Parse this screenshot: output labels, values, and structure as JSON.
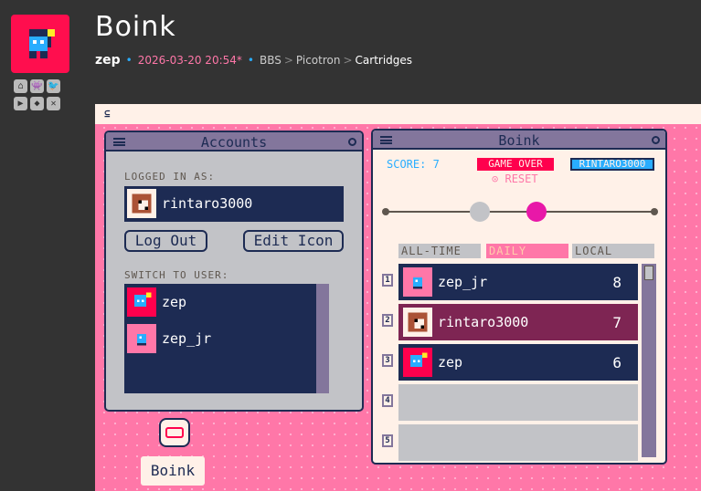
{
  "post": {
    "title": "Boink",
    "author": "zep",
    "date": "2026-03-20 20:54*",
    "breadcrumb": [
      "BBS",
      "Picotron",
      "Cartridges"
    ]
  },
  "colors": {
    "accent_pink": "#ff77a8",
    "navy": "#1d2b53",
    "red": "#ff004d",
    "blue": "#29adff",
    "magenta": "#e818a8",
    "wine": "#7e2553"
  },
  "accounts": {
    "title": "Accounts",
    "logged_in_label": "LOGGED IN AS:",
    "current_user": "rintaro3000",
    "logout_label": "Log Out",
    "edit_icon_label": "Edit Icon",
    "switch_label": "SWITCH TO USER:",
    "users": [
      "zep",
      "zep_jr"
    ]
  },
  "boink": {
    "title": "Boink",
    "score_label": "SCORE: 7",
    "game_over": "GAME OVER",
    "username": "RINTARO3000",
    "reset_label": "RESET",
    "tabs": [
      "ALL-TIME",
      "DAILY",
      "LOCAL"
    ],
    "leaderboard": [
      {
        "rank": "1",
        "name": "zep_jr",
        "score": "8"
      },
      {
        "rank": "2",
        "name": "rintaro3000",
        "score": "7"
      },
      {
        "rank": "3",
        "name": "zep",
        "score": "6"
      },
      {
        "rank": "4",
        "name": "",
        "score": ""
      },
      {
        "rank": "5",
        "name": "",
        "score": ""
      }
    ]
  },
  "desktop": {
    "icon_label": "Boink"
  },
  "social_icons": [
    "home-icon",
    "invader-icon",
    "twitter-icon",
    "youtube-icon",
    "discord-icon",
    "butterfly-icon"
  ]
}
